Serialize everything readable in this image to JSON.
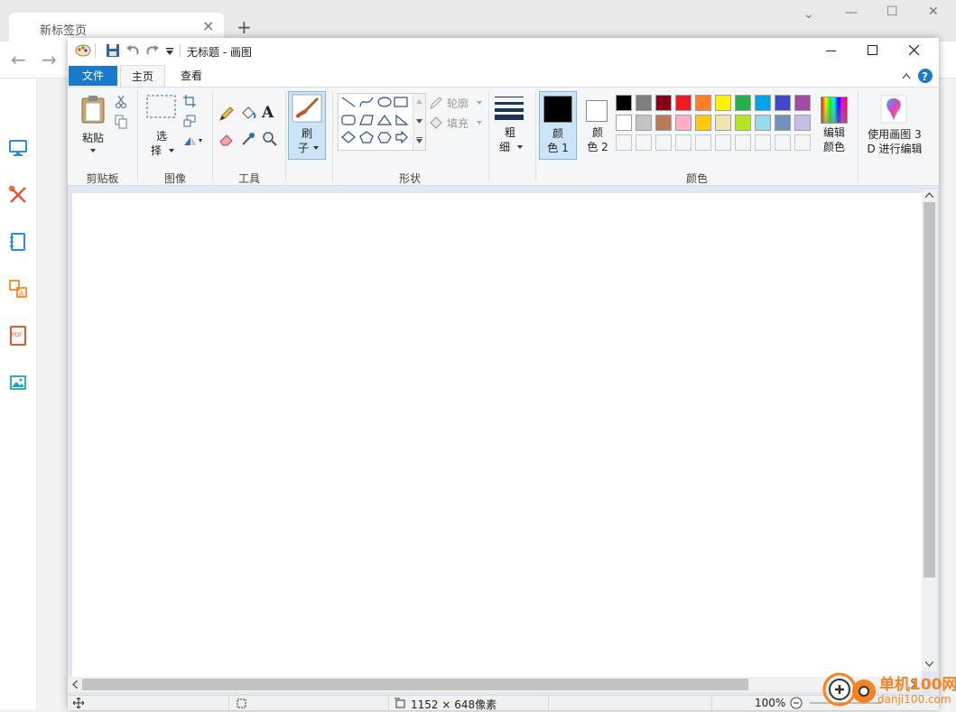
{
  "browser": {
    "tab_title": "新标签页",
    "tab_close": "×",
    "new_tab": "+",
    "back": "←",
    "forward": "→",
    "window_controls": {
      "minimize": "—",
      "maximize": "☐",
      "close": "✕",
      "dropdown": "⌄"
    }
  },
  "sidebar": {
    "items": [
      {
        "icon": "monitor-icon"
      },
      {
        "icon": "tools-icon"
      },
      {
        "icon": "notebook-icon"
      },
      {
        "icon": "translate-icon"
      },
      {
        "icon": "pdf-icon"
      },
      {
        "icon": "image-icon"
      }
    ],
    "pdf_text": "PDF"
  },
  "paint": {
    "title": "无标题 - 画图",
    "tabs": {
      "file": "文件",
      "home": "主页",
      "view": "查看"
    },
    "clipboard": {
      "paste": "粘贴",
      "label": "剪贴板"
    },
    "image": {
      "select_1": "选",
      "select_2": "择",
      "label": "图像"
    },
    "tools": {
      "label": "工具",
      "text_tool": "A"
    },
    "brush": {
      "line1": "刷",
      "line2": "子"
    },
    "shapes": {
      "outline": "轮廓",
      "fill": "填充",
      "label": "形状"
    },
    "size": {
      "line1": "粗",
      "line2": "细"
    },
    "colors": {
      "color1_a": "颜",
      "color1_b": "色 1",
      "color2_a": "颜",
      "color2_b": "色 2",
      "edit_a": "编辑",
      "edit_b": "颜色",
      "label": "颜色",
      "row1": [
        "#000000",
        "#7f7f7f",
        "#880015",
        "#ed1c24",
        "#ff7f27",
        "#fff200",
        "#22b14c",
        "#00a2e8",
        "#3f48cc",
        "#a349a4"
      ],
      "row2": [
        "#ffffff",
        "#c3c3c3",
        "#b97a57",
        "#ffaec9",
        "#ffc90e",
        "#efe4b0",
        "#b5e61d",
        "#99d9ea",
        "#7092be",
        "#c8bfe7"
      ]
    },
    "paint3d": {
      "line1": "使用画图 3",
      "line2": "D 进行编辑"
    },
    "status": {
      "dimensions": "1152 × 648像素",
      "zoom": "100%"
    }
  },
  "watermark": {
    "text1": "单机100网",
    "text2": "danji100.com"
  }
}
